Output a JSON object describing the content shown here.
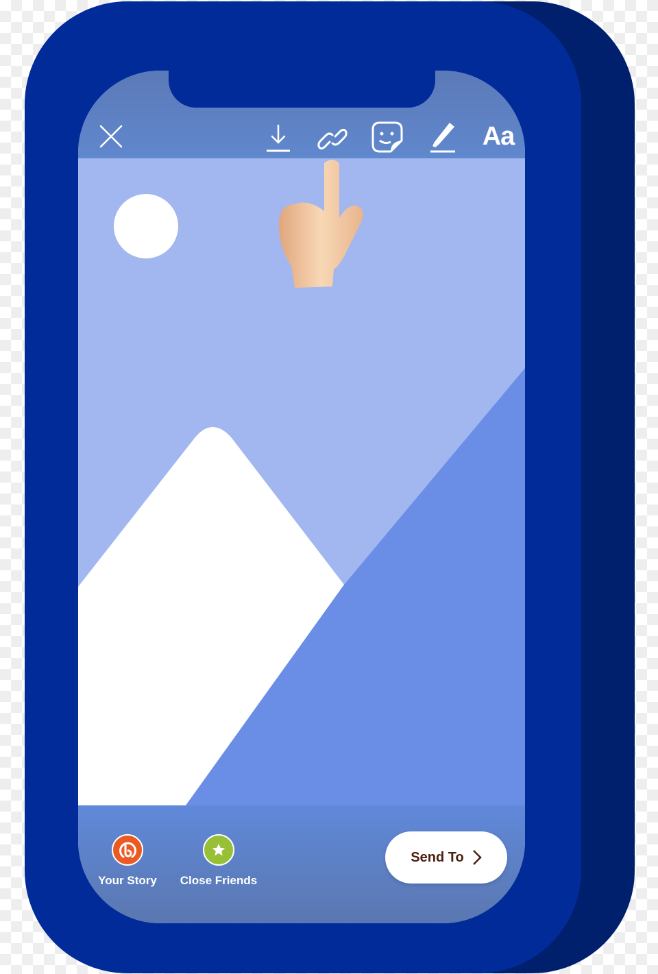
{
  "colors": {
    "phone_body": "#002b99",
    "phone_shadow": "#00206e",
    "sky": "#a2b7f0",
    "hill_dark": "#6a8ee6",
    "mountain": "#ffffff",
    "toolbar": "#5b79b8",
    "your_story_icon": "#ea5a22",
    "close_friends_icon": "#97c037",
    "send_text": "#4a1f0f"
  },
  "toolbar": {
    "close_icon": "close-icon",
    "download_icon": "download-icon",
    "link_icon": "link-icon",
    "sticker_icon": "sticker-icon",
    "draw_icon": "pen-icon",
    "text_label": "Aa"
  },
  "bottom": {
    "your_story_label": "Your Story",
    "close_friends_label": "Close Friends",
    "send_label": "Send To"
  },
  "pointer": "pointing-hand-emoji"
}
